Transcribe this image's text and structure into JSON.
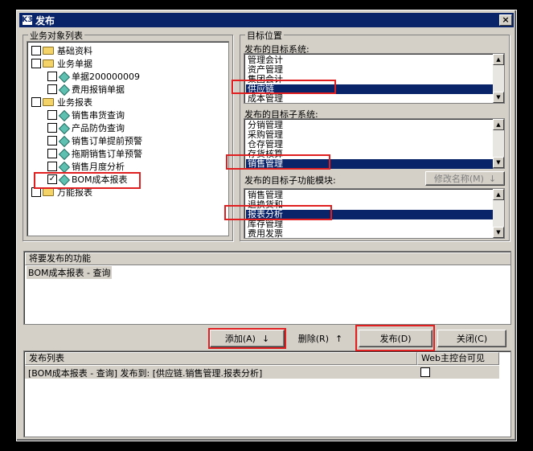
{
  "window": {
    "title": "发布",
    "icon_label": "K3",
    "close_label": "×"
  },
  "tree": {
    "group_label": "业务对象列表",
    "items": [
      {
        "label": "基础资料",
        "checked": false
      },
      {
        "label": "业务单据",
        "checked": false
      },
      {
        "label": "单据200000009",
        "checked": false
      },
      {
        "label": "费用报销单据",
        "checked": false
      },
      {
        "label": "业务报表",
        "checked": false
      },
      {
        "label": "销售串货查询",
        "checked": false
      },
      {
        "label": "产品防伪查询",
        "checked": false
      },
      {
        "label": "销售订单提前预警",
        "checked": false
      },
      {
        "label": "拖期销售订单预警",
        "checked": false
      },
      {
        "label": "销售月度分析",
        "checked": false
      },
      {
        "label": "BOM成本报表",
        "checked": true
      },
      {
        "label": "万能报表",
        "checked": false
      }
    ],
    "check_mark": "✓"
  },
  "target": {
    "group_label": "目标位置",
    "system_label": "发布的目标系统:",
    "systems": [
      "管理会计",
      "资产管理",
      "集团会计",
      "供应链",
      "成本管理"
    ],
    "selected_system": "供应链",
    "subsystem_label": "发布的目标子系统:",
    "subsystems": [
      "分销管理",
      "采购管理",
      "仓存管理",
      "存货核算",
      "销售管理"
    ],
    "selected_subsystem": "销售管理",
    "module_label": "发布的目标子功能模块:",
    "modules": [
      "销售管理",
      "退换货和",
      "报表分析",
      "库存管理",
      "费用发票"
    ],
    "selected_module": "报表分析",
    "rename_button": "修改名称(M)",
    "rename_arrow": "↓"
  },
  "functions": {
    "header": "将要发布的功能",
    "items": [
      "BOM成本报表 - 查询"
    ]
  },
  "buttons": {
    "add": "添加(A)",
    "add_arrow": "↓",
    "delete": "删除(R)",
    "delete_arrow": "↑",
    "publish": "发布(D)",
    "close": "关闭(C)"
  },
  "publish_list": {
    "col1": "发布列表",
    "col2": "Web主控台可见",
    "rows": [
      {
        "text": "[BOM成本报表 - 查询] 发布到: [供应链.销售管理.报表分析]",
        "web_visible": false
      }
    ]
  },
  "scroll_arrows": {
    "up": "▲",
    "down": "▼"
  }
}
